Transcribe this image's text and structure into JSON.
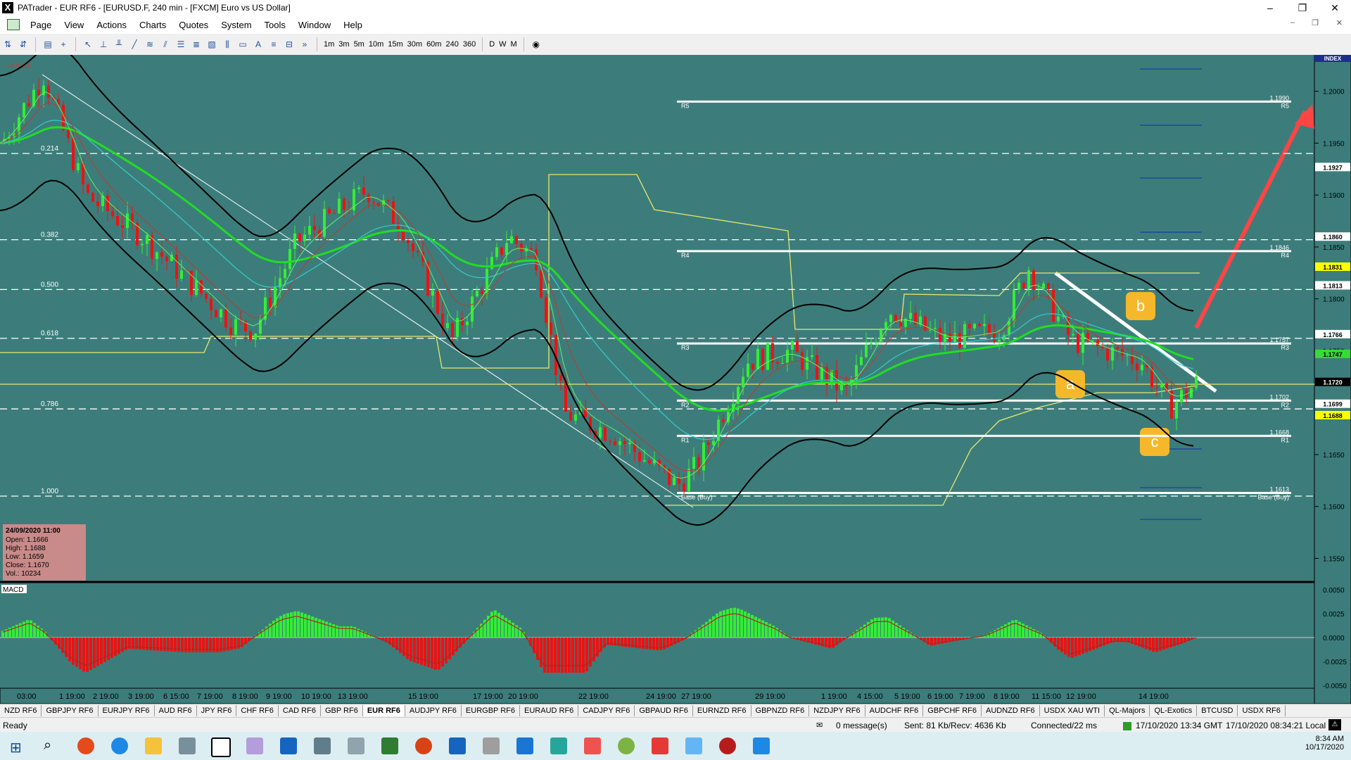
{
  "window": {
    "title": "PATrader - EUR RF6 - [EURUSD.F, 240 min - [FXCM] Euro vs US Dollar]",
    "app_icon": "X",
    "controls": {
      "minimize": "–",
      "maximize": "❐",
      "close": "✕"
    },
    "mdi_controls": {
      "minimize": "–",
      "restore": "❐",
      "close": "✕"
    }
  },
  "menu": [
    "Page",
    "View",
    "Actions",
    "Charts",
    "Quotes",
    "System",
    "Tools",
    "Window",
    "Help"
  ],
  "toolbar": {
    "timeframes": [
      "1m",
      "3m",
      "5m",
      "10m",
      "15m",
      "30m",
      "60m",
      "240",
      "360"
    ],
    "periods": [
      "D",
      "W",
      "M"
    ]
  },
  "chart": {
    "locked_label": "Locked",
    "index_label": "INDEX",
    "macd_label": "MACD",
    "fib_labels": [
      {
        "text": "0.214",
        "price": 1.194
      },
      {
        "text": "0.382",
        "price": 1.1857
      },
      {
        "text": "0.500",
        "price": 1.1809
      },
      {
        "text": "0.618",
        "price": 1.1762
      },
      {
        "text": "0.786",
        "price": 1.1694
      },
      {
        "text": "1.000",
        "price": 1.161
      }
    ],
    "pivots": [
      {
        "name": "R5",
        "value": "1.1990",
        "price": 1.199
      },
      {
        "name": "R4",
        "value": "1.1846",
        "price": 1.1846
      },
      {
        "name": "R3",
        "value": "1.1757",
        "price": 1.1757
      },
      {
        "name": "R2",
        "value": "1.1702",
        "price": 1.1702
      },
      {
        "name": "R1",
        "value": "1.1668",
        "price": 1.1668
      },
      {
        "name": "Base (Buy)",
        "value": "1.1613",
        "price": 1.1613
      }
    ],
    "price_axis": [
      "1.2000",
      "1.1950",
      "1.1900",
      "1.1850",
      "1.1800",
      "1.1750",
      "1.1700",
      "1.1650",
      "1.1600",
      "1.1550"
    ],
    "price_tags": [
      {
        "text": "1.1927",
        "price": 1.1927,
        "bg": "#ffffff",
        "fg": "#000000"
      },
      {
        "text": "1.1860",
        "price": 1.186,
        "bg": "#ffffff",
        "fg": "#000000"
      },
      {
        "text": "1.1831",
        "price": 1.1831,
        "bg": "#ffff00",
        "fg": "#000000"
      },
      {
        "text": "1.1813",
        "price": 1.1813,
        "bg": "#ffffff",
        "fg": "#000000"
      },
      {
        "text": "1.1766",
        "price": 1.1766,
        "bg": "#ffffff",
        "fg": "#000000"
      },
      {
        "text": "1.1747",
        "price": 1.1747,
        "bg": "#33dd33",
        "fg": "#000000"
      },
      {
        "text": "1.1720",
        "price": 1.172,
        "bg": "#000000",
        "fg": "#ffffff"
      },
      {
        "text": "1.1699",
        "price": 1.1699,
        "bg": "#ffffff",
        "fg": "#000000"
      },
      {
        "text": "1.1688",
        "price": 1.1688,
        "bg": "#ffff00",
        "fg": "#000000"
      }
    ],
    "macd_axis": [
      "0.0050",
      "0.0025",
      "0.0000",
      "-0.0025",
      "-0.0050"
    ],
    "time_axis": [
      "03:00",
      "1 19:00",
      "2 19:00",
      "3 19:00",
      "6 15:00",
      "7 19:00",
      "8 19:00",
      "9 19:00",
      "10 19:00",
      "13 19:00",
      "15 19:00",
      "17 19:00",
      "20 19:00",
      "22 19:00",
      "24 19:00",
      "27 19:00",
      "29 19:00",
      "1 19:00",
      "4 15:00",
      "5 19:00",
      "6 19:00",
      "7 19:00",
      "8 19:00",
      "11 15:00",
      "12 19:00",
      "14 19:00"
    ],
    "wave_labels": [
      {
        "text": "a"
      },
      {
        "text": "b"
      },
      {
        "text": "c"
      }
    ],
    "ohlc_box": {
      "date": "24/09/2020 11:00",
      "open": "Open: 1.1666",
      "high": "High: 1.1688",
      "low": "Low: 1.1659",
      "close": "Close: 1.1670",
      "vol": "Vol.: 10234"
    },
    "colors": {
      "background": "#3c7d7b",
      "bull": "#33ee33",
      "bear": "#ee1111",
      "ma_green": "#22dd22",
      "ma_cyan": "#33cccc",
      "bollinger": "#000000",
      "channel": "#e8e86a",
      "arrow": "#ff4444",
      "badge": "#f5b82a"
    }
  },
  "symbol_tabs": [
    "NZD RF6",
    "GBPJPY RF6",
    "EURJPY RF6",
    "AUD RF6",
    "JPY RF6",
    "CHF RF6",
    "CAD RF6",
    "GBP RF6",
    "EUR RF6",
    "AUDJPY RF6",
    "EURGBP RF6",
    "EURAUD RF6",
    "CADJPY RF6",
    "GBPAUD RF6",
    "EURNZD RF6",
    "GBPNZD RF6",
    "NZDJPY RF6",
    "AUDCHF RF6",
    "GBPCHF RF6",
    "AUDNZD RF6",
    "USDX XAU WTI",
    "QL-Majors",
    "QL-Exotics",
    "BTCUSD",
    "USDX RF6"
  ],
  "active_symbol_tab": "EUR RF6",
  "status": {
    "ready": "Ready",
    "messages": "0 message(s)",
    "traffic": "Sent: 81 Kb/Recv: 4636 Kb",
    "connection": "Connected/22 ms",
    "gmt": "17/10/2020 13:34 GMT",
    "local": "17/10/2020 08:34:21 Local"
  },
  "taskbar": {
    "time": "8:34 AM",
    "date": "10/17/2020"
  }
}
